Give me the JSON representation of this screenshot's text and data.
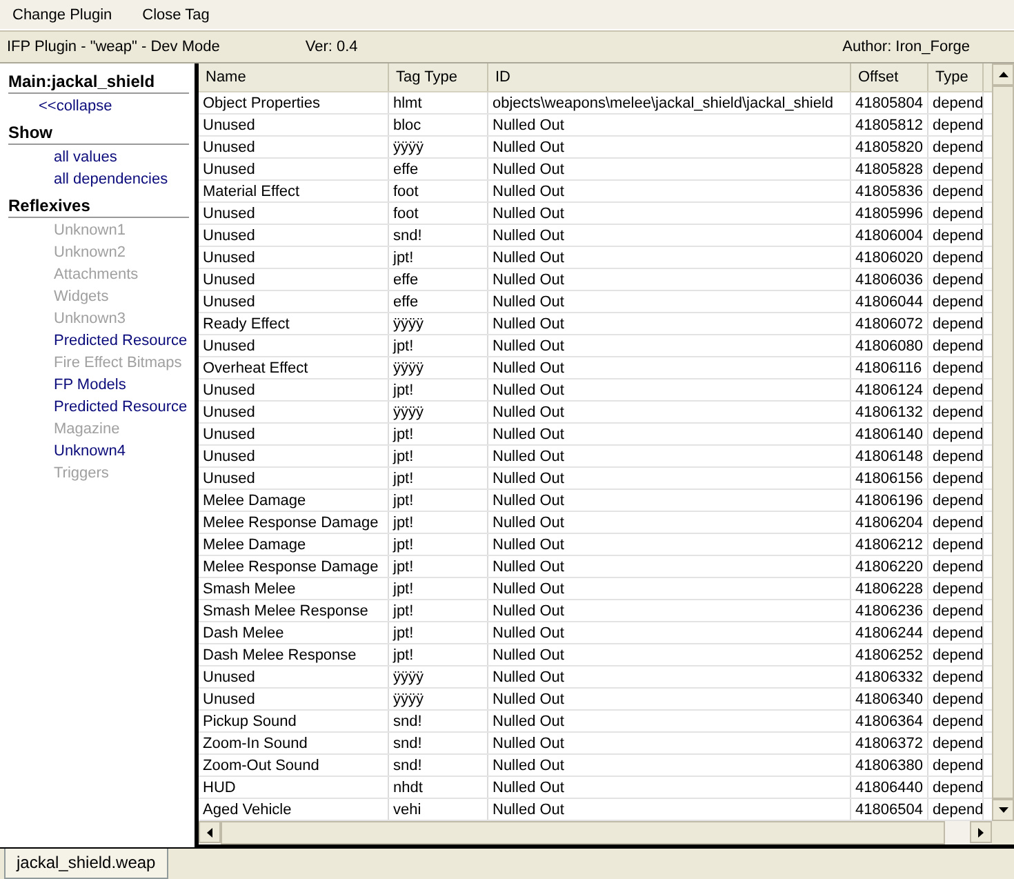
{
  "menu": [
    "Change Plugin",
    "Close Tag"
  ],
  "info": {
    "plugin": "IFP Plugin - \"weap\" - Dev Mode",
    "version": "Ver: 0.4",
    "author": "Author: Iron_Forge"
  },
  "sidebar": [
    {
      "title": "Main:jackal_shield",
      "items": [
        {
          "label": "<<collapse",
          "disabled": false
        }
      ]
    },
    {
      "title": "Show",
      "items": [
        {
          "label": "all values",
          "disabled": false
        },
        {
          "label": "all dependencies",
          "disabled": false
        }
      ]
    },
    {
      "title": "Reflexives",
      "items": [
        {
          "label": "Unknown1",
          "disabled": true
        },
        {
          "label": "Unknown2",
          "disabled": true
        },
        {
          "label": "Attachments",
          "disabled": true
        },
        {
          "label": "Widgets",
          "disabled": true
        },
        {
          "label": "Unknown3",
          "disabled": true
        },
        {
          "label": "Predicted Resource",
          "disabled": false
        },
        {
          "label": "Fire Effect Bitmaps",
          "disabled": true
        },
        {
          "label": "FP Models",
          "disabled": false
        },
        {
          "label": "Predicted Resource",
          "disabled": false
        },
        {
          "label": "Magazine",
          "disabled": true
        },
        {
          "label": "Unknown4",
          "disabled": false
        },
        {
          "label": "Triggers",
          "disabled": true
        }
      ]
    }
  ],
  "table": {
    "columns": [
      "Name",
      "Tag Type",
      "ID",
      "Offset",
      "Type"
    ],
    "rows": [
      [
        "Object Properties",
        "hlmt",
        "objects\\weapons\\melee\\jackal_shield\\jackal_shield",
        "41805804",
        "depend"
      ],
      [
        "Unused",
        "bloc",
        "Nulled Out",
        "41805812",
        "depend"
      ],
      [
        "Unused",
        "ÿÿÿÿ",
        "Nulled Out",
        "41805820",
        "depend"
      ],
      [
        "Unused",
        "effe",
        "Nulled Out",
        "41805828",
        "depend"
      ],
      [
        "Material Effect",
        "foot",
        "Nulled Out",
        "41805836",
        "depend"
      ],
      [
        "Unused",
        "foot",
        "Nulled Out",
        "41805996",
        "depend"
      ],
      [
        "Unused",
        "snd!",
        "Nulled Out",
        "41806004",
        "depend"
      ],
      [
        "Unused",
        "jpt!",
        "Nulled Out",
        "41806020",
        "depend"
      ],
      [
        "Unused",
        "effe",
        "Nulled Out",
        "41806036",
        "depend"
      ],
      [
        "Unused",
        "effe",
        "Nulled Out",
        "41806044",
        "depend"
      ],
      [
        "Ready Effect",
        "ÿÿÿÿ",
        "Nulled Out",
        "41806072",
        "depend"
      ],
      [
        "Unused",
        "jpt!",
        "Nulled Out",
        "41806080",
        "depend"
      ],
      [
        "Overheat Effect",
        "ÿÿÿÿ",
        "Nulled Out",
        "41806116",
        "depend"
      ],
      [
        "Unused",
        "jpt!",
        "Nulled Out",
        "41806124",
        "depend"
      ],
      [
        "Unused",
        "ÿÿÿÿ",
        "Nulled Out",
        "41806132",
        "depend"
      ],
      [
        "Unused",
        "jpt!",
        "Nulled Out",
        "41806140",
        "depend"
      ],
      [
        "Unused",
        "jpt!",
        "Nulled Out",
        "41806148",
        "depend"
      ],
      [
        "Unused",
        "jpt!",
        "Nulled Out",
        "41806156",
        "depend"
      ],
      [
        "Melee Damage",
        "jpt!",
        "Nulled Out",
        "41806196",
        "depend"
      ],
      [
        "Melee Response Damage",
        "jpt!",
        "Nulled Out",
        "41806204",
        "depend"
      ],
      [
        "Melee Damage",
        "jpt!",
        "Nulled Out",
        "41806212",
        "depend"
      ],
      [
        "Melee Response Damage",
        "jpt!",
        "Nulled Out",
        "41806220",
        "depend"
      ],
      [
        "Smash Melee",
        "jpt!",
        "Nulled Out",
        "41806228",
        "depend"
      ],
      [
        "Smash Melee Response",
        "jpt!",
        "Nulled Out",
        "41806236",
        "depend"
      ],
      [
        "Dash Melee",
        "jpt!",
        "Nulled Out",
        "41806244",
        "depend"
      ],
      [
        "Dash Melee Response",
        "jpt!",
        "Nulled Out",
        "41806252",
        "depend"
      ],
      [
        "Unused",
        "ÿÿÿÿ",
        "Nulled Out",
        "41806332",
        "depend"
      ],
      [
        "Unused",
        "ÿÿÿÿ",
        "Nulled Out",
        "41806340",
        "depend"
      ],
      [
        "Pickup Sound",
        "snd!",
        "Nulled Out",
        "41806364",
        "depend"
      ],
      [
        "Zoom-In Sound",
        "snd!",
        "Nulled Out",
        "41806372",
        "depend"
      ],
      [
        "Zoom-Out Sound",
        "snd!",
        "Nulled Out",
        "41806380",
        "depend"
      ],
      [
        "HUD",
        "nhdt",
        "Nulled Out",
        "41806440",
        "depend"
      ],
      [
        "Aged Vehicle",
        "vehi",
        "Nulled Out",
        "41806504",
        "depend"
      ]
    ]
  },
  "tabs": [
    {
      "label": "jackal_shield.weap",
      "selected": true
    }
  ]
}
